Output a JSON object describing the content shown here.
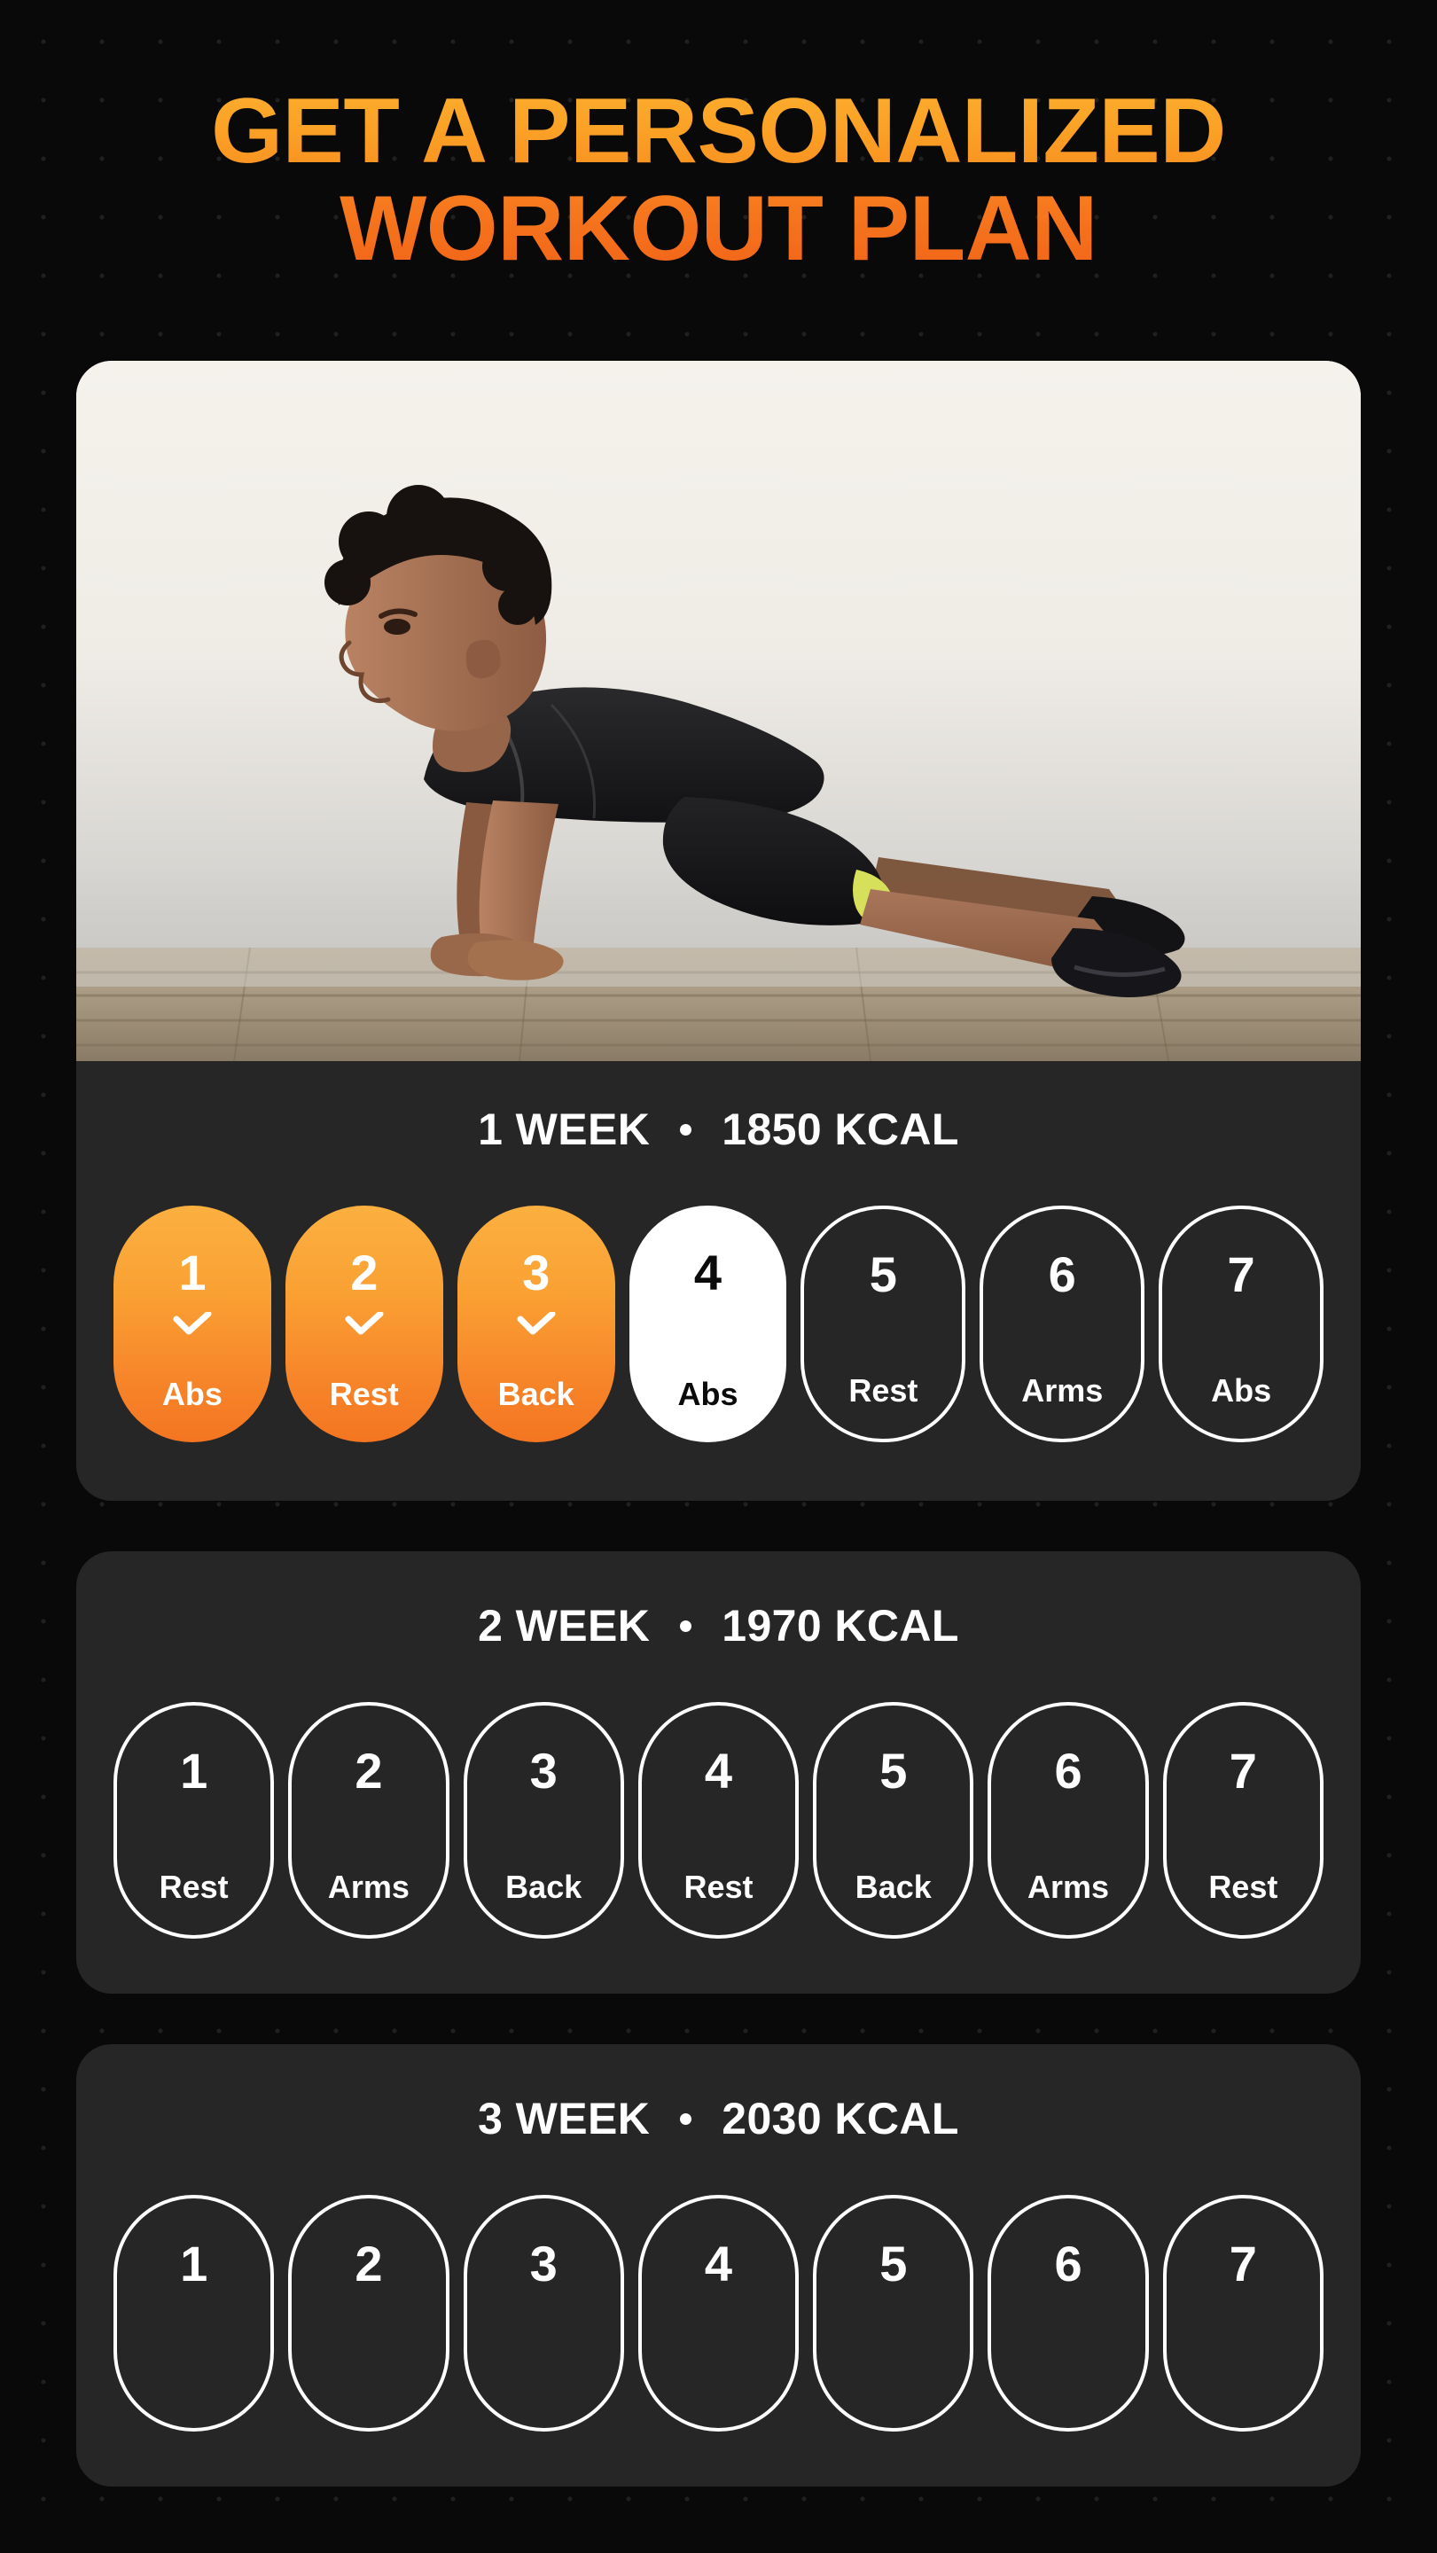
{
  "headline": {
    "line1": "GET A PERSONALIZED",
    "line2": "WORKOUT PLAN"
  },
  "colors": {
    "background": "#090909",
    "card": "#262626",
    "headline_top": "#FBAE2E",
    "headline_bottom": "#F26418",
    "pill_gradient_start": "#FBB040",
    "pill_gradient_end": "#F47521",
    "active_pill": "#FFFFFF",
    "text": "#FFFFFF"
  },
  "hero": {
    "alt": "man performing a push-up on a wooden dock in fog"
  },
  "separator": "•",
  "weeks": [
    {
      "title": "1 WEEK",
      "kcal": "1850 KCAL",
      "has_hero": true,
      "days": [
        {
          "num": "1",
          "label": "Abs",
          "state": "done"
        },
        {
          "num": "2",
          "label": "Rest",
          "state": "done"
        },
        {
          "num": "3",
          "label": "Back",
          "state": "done"
        },
        {
          "num": "4",
          "label": "Abs",
          "state": "active"
        },
        {
          "num": "5",
          "label": "Rest",
          "state": "todo"
        },
        {
          "num": "6",
          "label": "Arms",
          "state": "todo"
        },
        {
          "num": "7",
          "label": "Abs",
          "state": "todo"
        }
      ]
    },
    {
      "title": "2 WEEK",
      "kcal": "1970 KCAL",
      "has_hero": false,
      "days": [
        {
          "num": "1",
          "label": "Rest",
          "state": "todo"
        },
        {
          "num": "2",
          "label": "Arms",
          "state": "todo"
        },
        {
          "num": "3",
          "label": "Back",
          "state": "todo"
        },
        {
          "num": "4",
          "label": "Rest",
          "state": "todo"
        },
        {
          "num": "5",
          "label": "Back",
          "state": "todo"
        },
        {
          "num": "6",
          "label": "Arms",
          "state": "todo"
        },
        {
          "num": "7",
          "label": "Rest",
          "state": "todo"
        }
      ]
    },
    {
      "title": "3 WEEK",
      "kcal": "2030 KCAL",
      "has_hero": false,
      "clipped": true,
      "days": [
        {
          "num": "1",
          "label": "",
          "state": "todo"
        },
        {
          "num": "2",
          "label": "",
          "state": "todo"
        },
        {
          "num": "3",
          "label": "",
          "state": "todo"
        },
        {
          "num": "4",
          "label": "",
          "state": "todo"
        },
        {
          "num": "5",
          "label": "",
          "state": "todo"
        },
        {
          "num": "6",
          "label": "",
          "state": "todo"
        },
        {
          "num": "7",
          "label": "",
          "state": "todo"
        }
      ]
    }
  ]
}
